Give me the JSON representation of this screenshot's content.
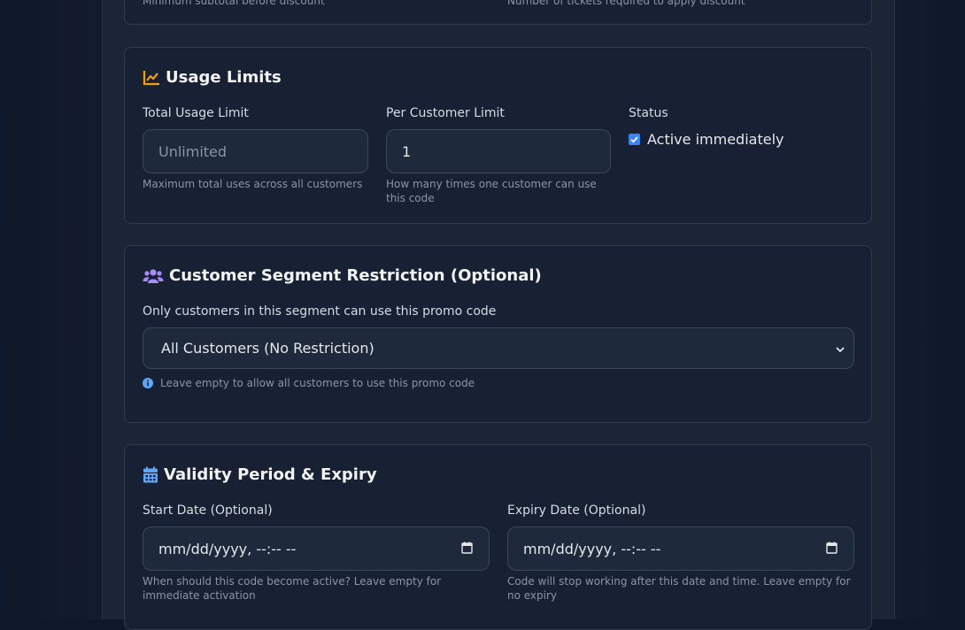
{
  "top_card": {
    "left_hint": "Minimum subtotal before discount",
    "right_hint": "Number of tickets required to apply discount"
  },
  "usage_limits": {
    "title": "Usage Limits",
    "icon": "chart-line-icon",
    "total_label": "Total Usage Limit",
    "total_placeholder": "Unlimited",
    "total_hint": "Maximum total uses across all customers",
    "per_customer_label": "Per Customer Limit",
    "per_customer_value": "1",
    "per_customer_hint_line1": "How many times one customer can use",
    "per_customer_hint_line2": "this code",
    "status_label": "Status",
    "status_checkbox_label": "Active immediately",
    "status_checked": true
  },
  "segment": {
    "title": "Customer Segment Restriction (Optional)",
    "icon": "users-icon",
    "description": "Only customers in this segment can use this promo code",
    "selected": "All Customers (No Restriction)",
    "hint": "Leave empty to allow all customers to use this promo code"
  },
  "validity": {
    "title": "Validity Period & Expiry",
    "icon": "calendar-icon",
    "start_label": "Start Date (Optional)",
    "start_placeholder": "mm/dd/yyyy, --:-- --",
    "start_hint_line1": "When should this code become active? Leave empty for",
    "start_hint_line2": "immediate activation",
    "expiry_label": "Expiry Date (Optional)",
    "expiry_placeholder": "mm/dd/yyyy, --:-- --",
    "expiry_hint_line1": "Code will stop working after this date and time. Leave empty for",
    "expiry_hint_line2": "no expiry"
  },
  "colors": {
    "usage_icon": "#f59e0b",
    "segment_icon": "#a78bfa",
    "calendar_icon": "#60a5fa",
    "info_icon": "#60a5fa",
    "checkbox": "#3b82f6"
  }
}
